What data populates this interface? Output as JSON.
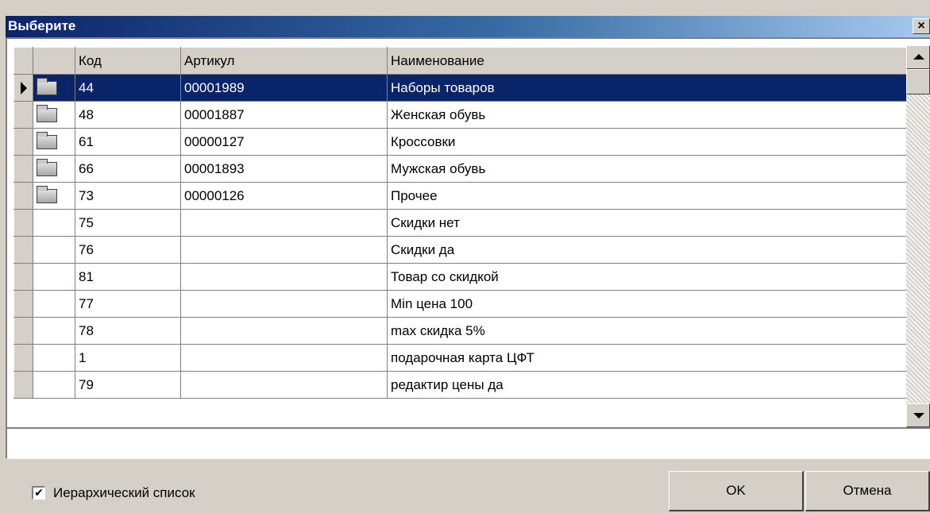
{
  "window": {
    "title": "Выберите",
    "close_glyph": "×"
  },
  "grid": {
    "columns": [
      "",
      "",
      "Код",
      "Артикул",
      "Наименование"
    ],
    "rows": [
      {
        "folder": true,
        "kod": "44",
        "artikul": "00001989",
        "name": "Наборы товаров",
        "selected": true
      },
      {
        "folder": true,
        "kod": "48",
        "artikul": "00001887",
        "name": "Женская обувь"
      },
      {
        "folder": true,
        "kod": "61",
        "artikul": "00000127",
        "name": "Кроссовки"
      },
      {
        "folder": true,
        "kod": "66",
        "artikul": "00001893",
        "name": "Мужская обувь"
      },
      {
        "folder": true,
        "kod": "73",
        "artikul": "00000126",
        "name": "Прочее"
      },
      {
        "folder": false,
        "kod": "75",
        "artikul": "",
        "name": "Скидки нет"
      },
      {
        "folder": false,
        "kod": "76",
        "artikul": "",
        "name": "Скидки да"
      },
      {
        "folder": false,
        "kod": "81",
        "artikul": "",
        "name": "Товар со скидкой"
      },
      {
        "folder": false,
        "kod": "77",
        "artikul": "",
        "name": "Min цена 100"
      },
      {
        "folder": false,
        "kod": "78",
        "artikul": "",
        "name": "max скидка 5%"
      },
      {
        "folder": false,
        "kod": "1",
        "artikul": "",
        "name": "подарочная карта ЦФТ"
      },
      {
        "folder": false,
        "kod": "79",
        "artikul": "",
        "name": "редактир цены да"
      }
    ]
  },
  "status_field": {
    "value": ""
  },
  "footer": {
    "hierarchical_checkbox": {
      "label": "Иерархический список",
      "checked": true,
      "glyph": "✔"
    },
    "ok_label": "OK",
    "cancel_label": "Отмена"
  },
  "colors": {
    "selection": "#0a246a",
    "face": "#d4d0c8",
    "title_gradient_start": "#0a246a",
    "title_gradient_end": "#a6caf0"
  }
}
